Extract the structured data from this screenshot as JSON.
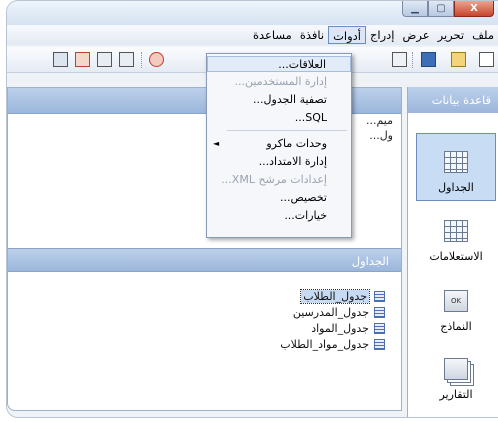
{
  "window": {
    "buttons": {
      "minimize": "▁",
      "maximize": "▢",
      "close": "X"
    }
  },
  "menubar": {
    "items": [
      {
        "id": "file",
        "label": "ملف"
      },
      {
        "id": "edit",
        "label": "تحرير"
      },
      {
        "id": "view",
        "label": "عرض"
      },
      {
        "id": "insert",
        "label": "إدراج"
      },
      {
        "id": "tools",
        "label": "أدوات"
      },
      {
        "id": "window",
        "label": "نافذة"
      },
      {
        "id": "help",
        "label": "مساعدة"
      }
    ]
  },
  "tools_menu": {
    "items": [
      {
        "label": "العلاقات...",
        "disabled": false
      },
      {
        "label": "إدارة المستخدمين...",
        "disabled": true
      },
      {
        "label": "تصفية الجدول...",
        "disabled": false
      },
      {
        "label": "SQL...",
        "disabled": false
      },
      {
        "label": "وحدات ماكرو",
        "disabled": false,
        "submenu": true
      },
      {
        "label": "إدارة الامتداد...",
        "disabled": false
      },
      {
        "label": "إعدادات مرشح XML...",
        "disabled": true
      },
      {
        "label": "تخصيص...",
        "disabled": false
      },
      {
        "label": "خيارات...",
        "disabled": false
      }
    ]
  },
  "upper_pane": {
    "fragments": [
      "ميم...",
      "ول..."
    ]
  },
  "tables_pane": {
    "header": "الجداول",
    "tables": [
      {
        "label": "جدول_الطلاب",
        "selected": true
      },
      {
        "label": "جدول_المدرسين",
        "selected": false
      },
      {
        "label": "جدول_المواد",
        "selected": false
      },
      {
        "label": "جدول_مواد_الطلاب",
        "selected": false
      }
    ]
  },
  "nav_pane": {
    "header": "قاعدة بيانات",
    "items": [
      {
        "label": "الجداول",
        "icon": "tables-icon",
        "selected": true
      },
      {
        "label": "الاستعلامات",
        "icon": "queries-icon",
        "selected": false
      },
      {
        "label": "النماذج",
        "icon": "forms-icon",
        "form_badge": "OK",
        "selected": false
      },
      {
        "label": "التقارير",
        "icon": "reports-icon",
        "selected": false
      }
    ]
  },
  "colors": {
    "header_blue": "#9bb6dc",
    "selection": "#c8dcf4",
    "close_red": "#c9442b"
  }
}
